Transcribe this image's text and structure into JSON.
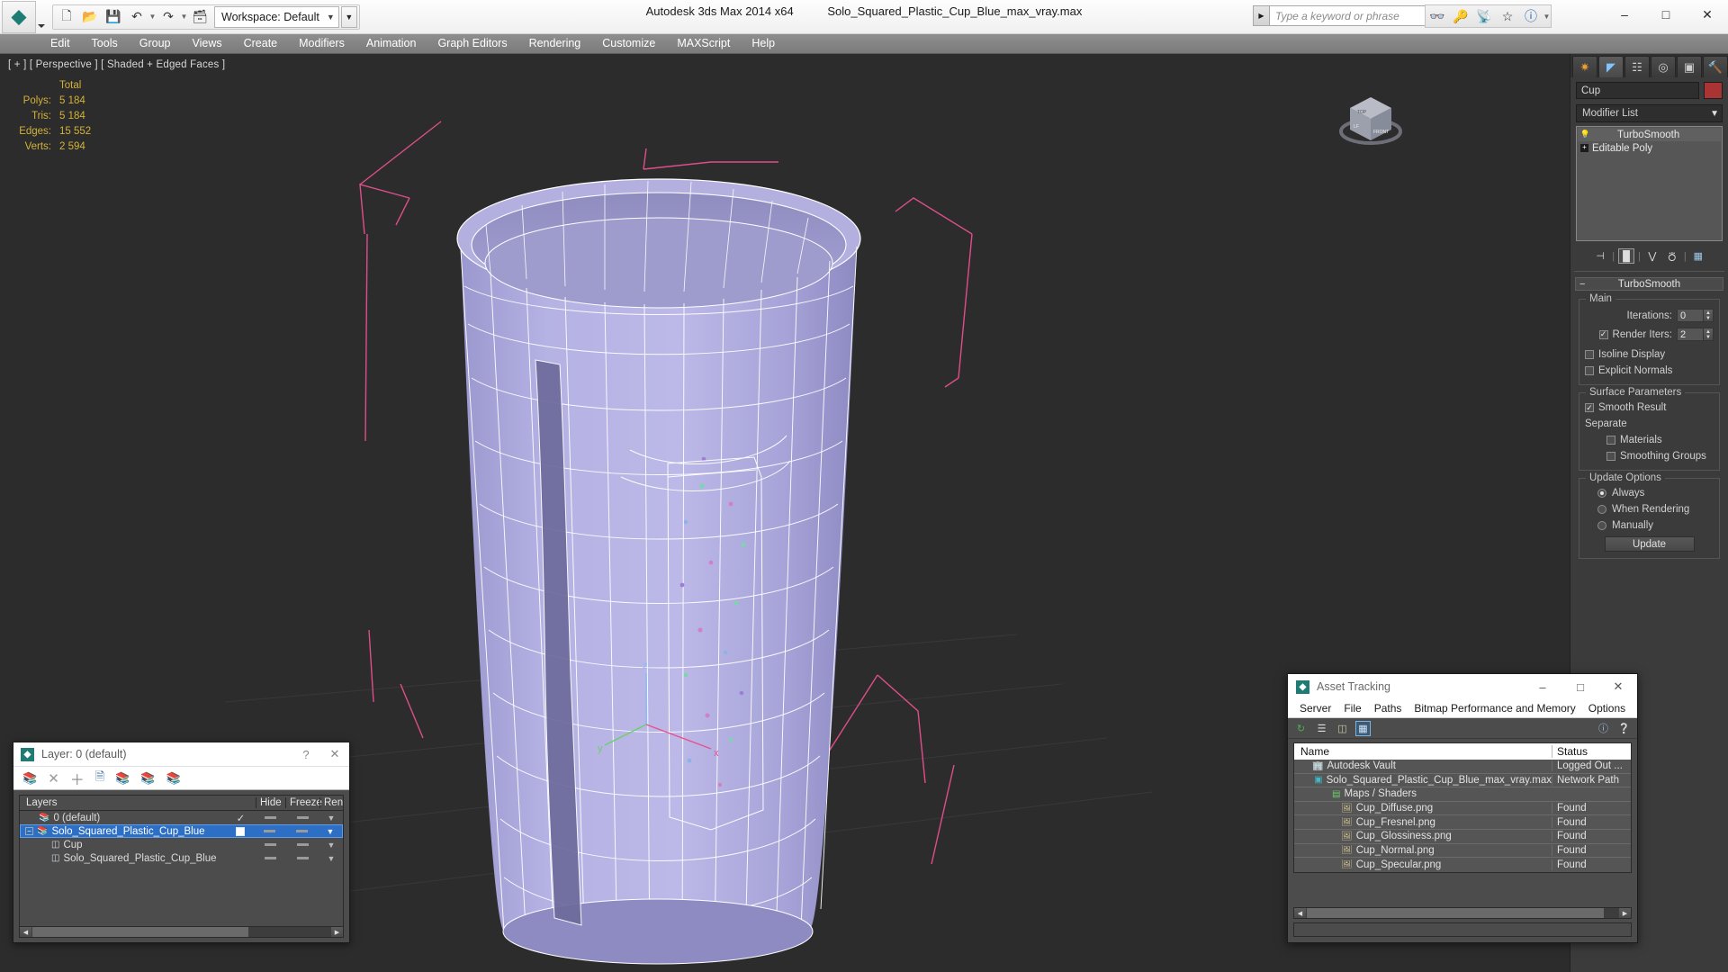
{
  "titlebar": {
    "app_title": "Autodesk 3ds Max  2014 x64",
    "file_name": "Solo_Squared_Plastic_Cup_Blue_max_vray.max",
    "workspace_label": "Workspace: Default",
    "quick_access": [
      {
        "name": "new-file-icon",
        "glyph": "□"
      },
      {
        "name": "open-file-icon",
        "glyph": "⌐"
      },
      {
        "name": "save-file-icon",
        "glyph": "▤"
      },
      {
        "name": "undo-icon",
        "glyph": "↶"
      },
      {
        "name": "redo-icon",
        "glyph": "↷"
      },
      {
        "name": "project-folder-icon",
        "glyph": "≣"
      }
    ],
    "search_placeholder": "Type a keyword or phrase",
    "help_icons": [
      {
        "name": "binoculars-icon",
        "glyph": "⚭"
      },
      {
        "name": "key-icon",
        "glyph": "⚷"
      },
      {
        "name": "satellite-icon",
        "glyph": "◢"
      },
      {
        "name": "star-icon",
        "glyph": "☆"
      },
      {
        "name": "help-circle-icon",
        "glyph": "?"
      }
    ],
    "window_controls": [
      {
        "name": "minimize-button",
        "glyph": "─"
      },
      {
        "name": "maximize-button",
        "glyph": "□"
      },
      {
        "name": "close-button",
        "glyph": "✕"
      }
    ]
  },
  "menubar": {
    "items": [
      "Edit",
      "Tools",
      "Group",
      "Views",
      "Create",
      "Modifiers",
      "Animation",
      "Graph Editors",
      "Rendering",
      "Customize",
      "MAXScript",
      "Help"
    ]
  },
  "viewport": {
    "label": "[ + ] [ Perspective ] [ Shaded + Edged Faces ]",
    "stats": {
      "column_header": "Total",
      "rows": [
        {
          "label": "Polys:",
          "value": "5 184"
        },
        {
          "label": "Tris:",
          "value": "5 184"
        },
        {
          "label": "Edges:",
          "value": "15 552"
        },
        {
          "label": "Verts:",
          "value": "2 594"
        }
      ]
    },
    "viewcube_faces": [
      "TOP",
      "FRONT",
      "LEFT"
    ],
    "axis_labels": [
      "x",
      "y",
      "z"
    ],
    "model_color": "#b3b0e0",
    "wireframe_color": "#ffffff",
    "gizmo_color": "#e8508f"
  },
  "command_panel": {
    "tabs": [
      {
        "name": "create-tab",
        "glyph": "✹"
      },
      {
        "name": "modify-tab",
        "glyph": "◠"
      },
      {
        "name": "hierarchy-tab",
        "glyph": "⑂"
      },
      {
        "name": "motion-tab",
        "glyph": "◎"
      },
      {
        "name": "display-tab",
        "glyph": "▣"
      },
      {
        "name": "utilities-tab",
        "glyph": "⚒"
      }
    ],
    "active_tab_index": 1,
    "object_name": "Cup",
    "object_color": "#a03030",
    "modifier_list_label": "Modifier List",
    "modifier_stack": [
      {
        "label": "TurboSmooth",
        "icon": "lightbulb-icon",
        "selected": true
      },
      {
        "label": "Editable Poly",
        "icon": "expand-plus-icon",
        "selected": false
      }
    ],
    "stack_buttons": [
      {
        "name": "pin-stack-icon",
        "glyph": "⊣"
      },
      {
        "name": "show-end-result-icon",
        "glyph": "█"
      },
      {
        "name": "make-unique-icon",
        "glyph": "∨"
      },
      {
        "name": "remove-modifier-icon",
        "glyph": "⛃"
      },
      {
        "name": "configure-sets-icon",
        "glyph": "▦"
      }
    ],
    "rollout": {
      "title": "TurboSmooth",
      "groups": [
        {
          "title": "Main",
          "fields": [
            {
              "type": "spinner",
              "label": "Iterations:",
              "value": "0"
            },
            {
              "type": "checkbox-spinner",
              "label": "Render Iters:",
              "value": "2",
              "checked": true
            },
            {
              "type": "checkbox",
              "label": "Isoline Display",
              "checked": false
            },
            {
              "type": "checkbox",
              "label": "Explicit Normals",
              "checked": false
            }
          ]
        },
        {
          "title": "Surface Parameters",
          "fields": [
            {
              "type": "checkbox",
              "label": "Smooth Result",
              "checked": true
            },
            {
              "type": "text",
              "label": "Separate"
            },
            {
              "type": "checkbox-indent",
              "label": "Materials",
              "checked": false
            },
            {
              "type": "checkbox-indent",
              "label": "Smoothing Groups",
              "checked": false
            }
          ]
        },
        {
          "title": "Update Options",
          "fields": [
            {
              "type": "radio",
              "label": "Always",
              "checked": true
            },
            {
              "type": "radio",
              "label": "When Rendering",
              "checked": false
            },
            {
              "type": "radio",
              "label": "Manually",
              "checked": false
            },
            {
              "type": "button",
              "label": "Update"
            }
          ]
        }
      ]
    }
  },
  "layer_dialog": {
    "title": "Layer: 0 (default)",
    "help_glyph": "?",
    "close_glyph": "✕",
    "toolbar_icons": [
      {
        "name": "new-layer-icon",
        "glyph": "≣"
      },
      {
        "name": "delete-layer-icon",
        "glyph": "✕"
      },
      {
        "name": "add-to-layer-icon",
        "glyph": "＋"
      },
      {
        "name": "select-objects-in-layer-icon",
        "glyph": "◰"
      },
      {
        "name": "set-current-layer-icon",
        "glyph": "≣"
      },
      {
        "name": "select-highlighted-icon",
        "glyph": "≣"
      },
      {
        "name": "layer-properties-icon",
        "glyph": "≣"
      }
    ],
    "columns": [
      "Layers",
      "",
      "Hide",
      "Freeze",
      "Ren"
    ],
    "rows": [
      {
        "label": "0 (default)",
        "icon": "layers-icon",
        "indent": 1,
        "expander": "",
        "current": "✓",
        "hide": "dash",
        "freeze": "dash",
        "render": "▼",
        "selected": false
      },
      {
        "label": "Solo_Squared_Plastic_Cup_Blue",
        "icon": "layers-icon",
        "indent": 0,
        "expander": "−",
        "current": "box",
        "hide": "dash",
        "freeze": "dash",
        "render": "▼",
        "selected": true
      },
      {
        "label": "Cup",
        "icon": "object-icon",
        "indent": 2,
        "expander": "",
        "current": "",
        "hide": "dash",
        "freeze": "dash",
        "render": "▼",
        "selected": false
      },
      {
        "label": "Solo_Squared_Plastic_Cup_Blue",
        "icon": "object-icon",
        "indent": 2,
        "expander": "",
        "current": "",
        "hide": "dash",
        "freeze": "dash",
        "render": "▼",
        "selected": false
      }
    ]
  },
  "asset_tracking": {
    "title": "Asset Tracking",
    "window_controls": [
      {
        "name": "minimize-button",
        "glyph": "─"
      },
      {
        "name": "maximize-button",
        "glyph": "□"
      },
      {
        "name": "close-button",
        "glyph": "✕"
      }
    ],
    "menu": [
      "Server",
      "File",
      "Paths",
      "Bitmap Performance and Memory",
      "Options"
    ],
    "toolbar_icons": [
      {
        "name": "refresh-icon",
        "glyph": "↻"
      },
      {
        "name": "list-view-icon",
        "glyph": "≡"
      },
      {
        "name": "detail-view-icon",
        "glyph": "▥"
      },
      {
        "name": "grid-view-icon",
        "glyph": "▦"
      },
      {
        "name": "help-icon",
        "glyph": "?"
      },
      {
        "name": "whats-this-icon",
        "glyph": "?"
      }
    ],
    "active_toolbar_index": 3,
    "columns": [
      "Name",
      "Status"
    ],
    "rows": [
      {
        "name": "Autodesk Vault",
        "status": "Logged Out ...",
        "icon": "vault-icon",
        "indent": 1
      },
      {
        "name": "Solo_Squared_Plastic_Cup_Blue_max_vray.max",
        "status": "Network Path",
        "icon": "max-file-icon",
        "indent": 2
      },
      {
        "name": "Maps / Shaders",
        "status": "",
        "icon": "maps-icon",
        "indent": 3
      },
      {
        "name": "Cup_Diffuse.png",
        "status": "Found",
        "icon": "bitmap-icon",
        "indent": 4
      },
      {
        "name": "Cup_Fresnel.png",
        "status": "Found",
        "icon": "bitmap-icon",
        "indent": 4
      },
      {
        "name": "Cup_Glossiness.png",
        "status": "Found",
        "icon": "bitmap-icon",
        "indent": 4
      },
      {
        "name": "Cup_Normal.png",
        "status": "Found",
        "icon": "bitmap-icon",
        "indent": 4
      },
      {
        "name": "Cup_Specular.png",
        "status": "Found",
        "icon": "bitmap-icon",
        "indent": 4
      }
    ]
  }
}
